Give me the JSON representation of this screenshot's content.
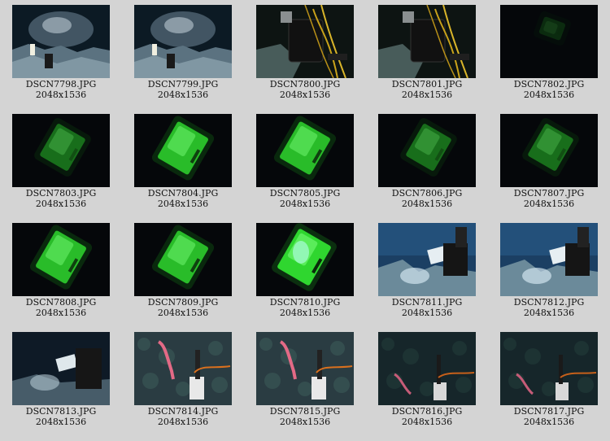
{
  "thumbnails": [
    {
      "filename": "DSCN7798.JPG",
      "dimensions": "2048x1536",
      "scene": "rocky-seafloor-plume"
    },
    {
      "filename": "DSCN7799.JPG",
      "dimensions": "2048x1536",
      "scene": "rocky-seafloor-plume"
    },
    {
      "filename": "DSCN7800.JPG",
      "dimensions": "2048x1536",
      "scene": "camera-housing-cables"
    },
    {
      "filename": "DSCN7801.JPG",
      "dimensions": "2048x1536",
      "scene": "camera-housing-cables"
    },
    {
      "filename": "DSCN7802.JPG",
      "dimensions": "2048x1536",
      "scene": "dark-faint-green"
    },
    {
      "filename": "DSCN7803.JPG",
      "dimensions": "2048x1536",
      "scene": "green-panel-dim"
    },
    {
      "filename": "DSCN7804.JPG",
      "dimensions": "2048x1536",
      "scene": "green-panel-bright"
    },
    {
      "filename": "DSCN7805.JPG",
      "dimensions": "2048x1536",
      "scene": "green-panel-bright"
    },
    {
      "filename": "DSCN7806.JPG",
      "dimensions": "2048x1536",
      "scene": "green-panel-dim"
    },
    {
      "filename": "DSCN7807.JPG",
      "dimensions": "2048x1536",
      "scene": "green-panel-dim"
    },
    {
      "filename": "DSCN7808.JPG",
      "dimensions": "2048x1536",
      "scene": "green-panel-bright"
    },
    {
      "filename": "DSCN7809.JPG",
      "dimensions": "2048x1536",
      "scene": "green-panel-bright"
    },
    {
      "filename": "DSCN7810.JPG",
      "dimensions": "2048x1536",
      "scene": "green-panel-brightest"
    },
    {
      "filename": "DSCN7811.JPG",
      "dimensions": "2048x1536",
      "scene": "instrument-blue-water"
    },
    {
      "filename": "DSCN7812.JPG",
      "dimensions": "2048x1536",
      "scene": "instrument-blue-water"
    },
    {
      "filename": "DSCN7813.JPG",
      "dimensions": "2048x1536",
      "scene": "instrument-dark-plume"
    },
    {
      "filename": "DSCN7814.JPG",
      "dimensions": "2048x1536",
      "scene": "pink-creature-seafloor"
    },
    {
      "filename": "DSCN7815.JPG",
      "dimensions": "2048x1536",
      "scene": "pink-creature-seafloor"
    },
    {
      "filename": "DSCN7816.JPG",
      "dimensions": "2048x1536",
      "scene": "pink-creature-seafloor-dark"
    },
    {
      "filename": "DSCN7817.JPG",
      "dimensions": "2048x1536",
      "scene": "pink-creature-seafloor-dark"
    }
  ],
  "colors": {
    "background": "#d4d4d4",
    "caption": "#111111",
    "green_glow": "#3cff3c",
    "deep_blue": "#0b1f3a"
  }
}
